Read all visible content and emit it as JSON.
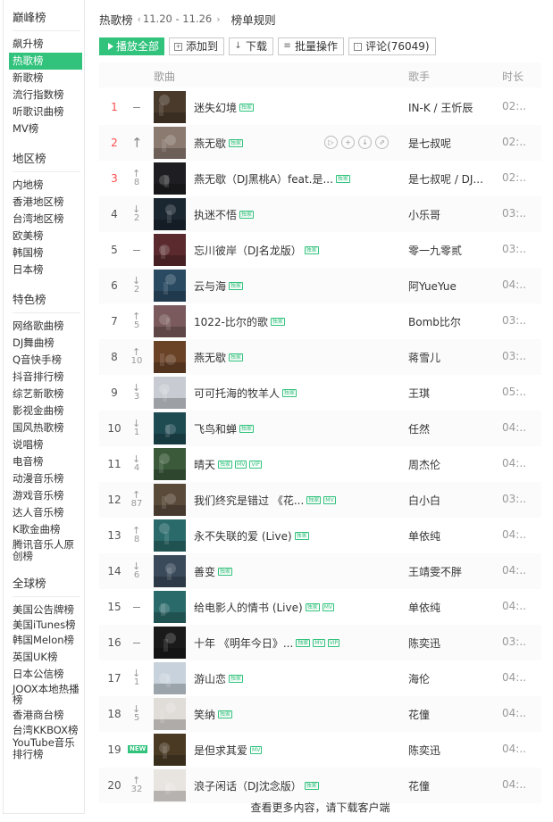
{
  "sidebar": {
    "groups": [
      {
        "title": "巅峰榜",
        "items": [
          {
            "label": "飙升榜"
          },
          {
            "label": "热歌榜",
            "active": true
          },
          {
            "label": "新歌榜"
          },
          {
            "label": "流行指数榜"
          },
          {
            "label": "听歌识曲榜"
          },
          {
            "label": "MV榜"
          }
        ]
      },
      {
        "title": "地区榜",
        "items": [
          {
            "label": "内地榜"
          },
          {
            "label": "香港地区榜"
          },
          {
            "label": "台湾地区榜"
          },
          {
            "label": "欧美榜"
          },
          {
            "label": "韩国榜"
          },
          {
            "label": "日本榜"
          }
        ]
      },
      {
        "title": "特色榜",
        "items": [
          {
            "label": "网络歌曲榜"
          },
          {
            "label": "DJ舞曲榜"
          },
          {
            "label": "Q音快手榜"
          },
          {
            "label": "抖音排行榜"
          },
          {
            "label": "综艺新歌榜"
          },
          {
            "label": "影视金曲榜"
          },
          {
            "label": "国风热歌榜"
          },
          {
            "label": "说唱榜"
          },
          {
            "label": "电音榜"
          },
          {
            "label": "动漫音乐榜"
          },
          {
            "label": "游戏音乐榜"
          },
          {
            "label": "达人音乐榜"
          },
          {
            "label": "K歌金曲榜"
          },
          {
            "label": "腾讯音乐人原创榜",
            "multi": true
          }
        ]
      },
      {
        "title": "全球榜",
        "items": [
          {
            "label": "美国公告牌榜"
          },
          {
            "label": "美国iTunes榜",
            "multi": true
          },
          {
            "label": "韩国Melon榜"
          },
          {
            "label": "英国UK榜"
          },
          {
            "label": "日本公信榜"
          },
          {
            "label": "JOOX本地热播榜",
            "multi": true
          },
          {
            "label": "香港商台榜"
          },
          {
            "label": "台湾KKBOX榜",
            "multi": true
          },
          {
            "label": "YouTube音乐排行榜",
            "multi": true
          }
        ]
      }
    ]
  },
  "header": {
    "title": "热歌榜",
    "date_range": "11.20 - 11.26",
    "rules_label": "榜单规则",
    "prev_arrow": "‹",
    "next_arrow": "›"
  },
  "toolbar": {
    "play_all": "播放全部",
    "add_to": "添加到",
    "download": "下载",
    "batch": "批量操作",
    "comments": "评论(76049)"
  },
  "table": {
    "col_song": "歌曲",
    "col_singer": "歌手",
    "col_duration": "时长"
  },
  "songs": [
    {
      "rank": "1",
      "trend": "dash",
      "title": "迷失幻境",
      "tags": [
        "独家"
      ],
      "singer": "IN-K / 王忻辰",
      "duration": "02:..",
      "color": "#4a3a2c"
    },
    {
      "rank": "2",
      "trend": "up",
      "title": "燕无歇",
      "tags": [
        "独家"
      ],
      "singer": "是七叔呢",
      "duration": "02:..",
      "color": "#8a7a70",
      "hover": true
    },
    {
      "rank": "3",
      "trend": "up",
      "trend_num": "8",
      "title": "燕无歇（DJ黑桃A）feat.是...",
      "tags": [
        "独家"
      ],
      "singer": "是七叔呢 / DJ...",
      "duration": "02:..",
      "color": "#1e1e22"
    },
    {
      "rank": "4",
      "trend": "down",
      "trend_num": "2",
      "title": "执迷不悟",
      "tags": [
        "独家"
      ],
      "singer": "小乐哥",
      "duration": "03:..",
      "color": "#1a2630"
    },
    {
      "rank": "5",
      "trend": "dash",
      "title": "忘川彼岸（DJ名龙版）",
      "tags": [
        "独家"
      ],
      "singer": "零一九零贰",
      "duration": "03:..",
      "color": "#5a2a2e"
    },
    {
      "rank": "6",
      "trend": "down",
      "trend_num": "2",
      "title": "云与海",
      "tags": [
        "独家"
      ],
      "singer": "阿YueYue",
      "duration": "04:..",
      "color": "#2a4a62"
    },
    {
      "rank": "7",
      "trend": "up",
      "trend_num": "5",
      "title": "1022-比尔的歌",
      "tags": [
        "独家"
      ],
      "singer": "Bomb比尔",
      "duration": "03:..",
      "color": "#7a5a5c"
    },
    {
      "rank": "8",
      "trend": "up",
      "trend_num": "10",
      "title": "燕无歇",
      "tags": [
        "独家"
      ],
      "singer": "蒋雪儿",
      "duration": "03:..",
      "color": "#6a4226"
    },
    {
      "rank": "9",
      "trend": "down",
      "trend_num": "3",
      "title": "可可托海的牧羊人",
      "tags": [
        "独家"
      ],
      "singer": "王琪",
      "duration": "05:..",
      "color": "#c8ccd2"
    },
    {
      "rank": "10",
      "trend": "down",
      "trend_num": "1",
      "title": "飞鸟和蝉",
      "tags": [
        "独家"
      ],
      "singer": "任然",
      "duration": "04:..",
      "color": "#1e4a52"
    },
    {
      "rank": "11",
      "trend": "down",
      "trend_num": "4",
      "title": "晴天",
      "tags": [
        "独家",
        "MV",
        "VIP"
      ],
      "singer": "周杰伦",
      "duration": "04:..",
      "color": "#3a5a3a"
    },
    {
      "rank": "12",
      "trend": "up",
      "trend_num": "87",
      "title": "我们终究是错过 《花...",
      "tags": [
        "独家",
        "MV"
      ],
      "singer": "白小白",
      "duration": "03:..",
      "color": "#5a4a3a"
    },
    {
      "rank": "13",
      "trend": "up",
      "trend_num": "8",
      "title": "永不失联的爱 (Live)",
      "tags": [
        "独家"
      ],
      "singer": "单依纯",
      "duration": "04:..",
      "color": "#2a6a6a"
    },
    {
      "rank": "14",
      "trend": "down",
      "trend_num": "6",
      "title": "善变",
      "tags": [
        "独家"
      ],
      "singer": "王靖雯不胖",
      "duration": "04:..",
      "color": "#3a4a5a"
    },
    {
      "rank": "15",
      "trend": "dash",
      "title": "给电影人的情书 (Live)",
      "tags": [
        "独家",
        "MV"
      ],
      "singer": "单依纯",
      "duration": "04:..",
      "color": "#2a6a6a"
    },
    {
      "rank": "16",
      "trend": "dash",
      "title": "十年 《明年今日》...",
      "tags": [
        "独家",
        "MV",
        "VIP"
      ],
      "singer": "陈奕迅",
      "duration": "03:..",
      "color": "#1a1a1a"
    },
    {
      "rank": "17",
      "trend": "down",
      "trend_num": "1",
      "title": "游山恋",
      "tags": [
        "独家"
      ],
      "singer": "海伦",
      "duration": "04:..",
      "color": "#c8d2dc"
    },
    {
      "rank": "18",
      "trend": "down",
      "trend_num": "5",
      "title": "笑纳",
      "tags": [
        "独家"
      ],
      "singer": "花僮",
      "duration": "04:..",
      "color": "#e0dcd8"
    },
    {
      "rank": "19",
      "trend": "new",
      "trend_label": "NEW",
      "title": "是但求其爱",
      "tags": [
        "MV"
      ],
      "singer": "陈奕迅",
      "duration": "04:..",
      "color": "#4a3a24"
    },
    {
      "rank": "20",
      "trend": "up",
      "trend_num": "32",
      "title": "浪子闲话（DJ沈念版）",
      "tags": [
        "独家"
      ],
      "singer": "花僮",
      "duration": "04:..",
      "color": "#e8e4e0"
    }
  ],
  "row_actions": [
    "play-icon",
    "add-icon",
    "download-icon",
    "share-icon"
  ],
  "footer": "查看更多内容，请下载客户端",
  "colors": {
    "accent": "#31c27c",
    "top_rank": "#ff4c4c"
  }
}
